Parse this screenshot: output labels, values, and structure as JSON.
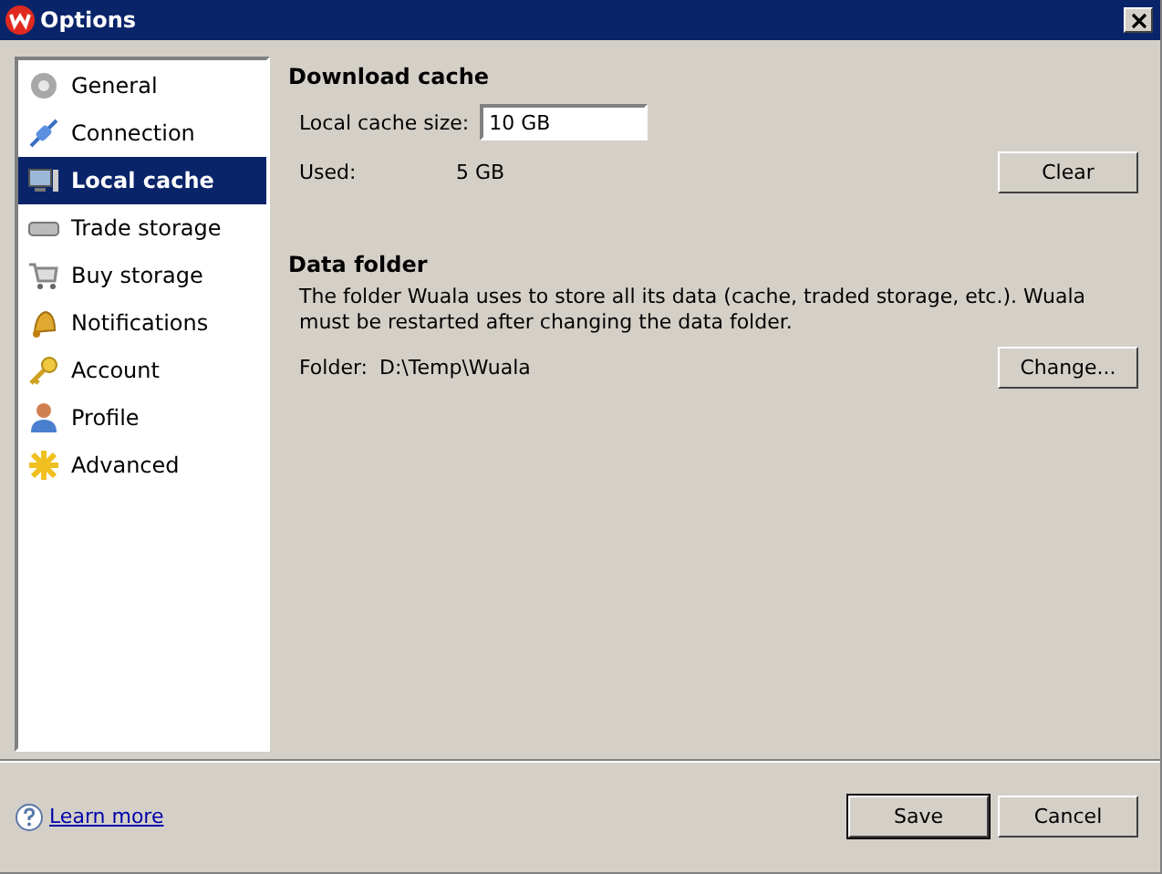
{
  "window": {
    "title": "Options"
  },
  "sidebar": {
    "items": [
      {
        "label": "General",
        "selected": false
      },
      {
        "label": "Connection",
        "selected": false
      },
      {
        "label": "Local cache",
        "selected": true
      },
      {
        "label": "Trade storage",
        "selected": false
      },
      {
        "label": "Buy storage",
        "selected": false
      },
      {
        "label": "Notifications",
        "selected": false
      },
      {
        "label": "Account",
        "selected": false
      },
      {
        "label": "Profile",
        "selected": false
      },
      {
        "label": "Advanced",
        "selected": false
      }
    ]
  },
  "download_cache": {
    "heading": "Download cache",
    "size_label": "Local cache size:",
    "size_value": "10 GB",
    "used_label": "Used:",
    "used_value": "5 GB",
    "clear_button": "Clear"
  },
  "data_folder": {
    "heading": "Data folder",
    "description": "The folder Wuala uses to store all its data (cache, traded storage, etc.). Wuala must be restarted after changing the data folder.",
    "folder_label": "Folder:",
    "folder_value": "D:\\Temp\\Wuala",
    "change_button": "Change..."
  },
  "footer": {
    "help_link": "Learn more",
    "buttons": [
      "Save",
      "Cancel"
    ]
  }
}
